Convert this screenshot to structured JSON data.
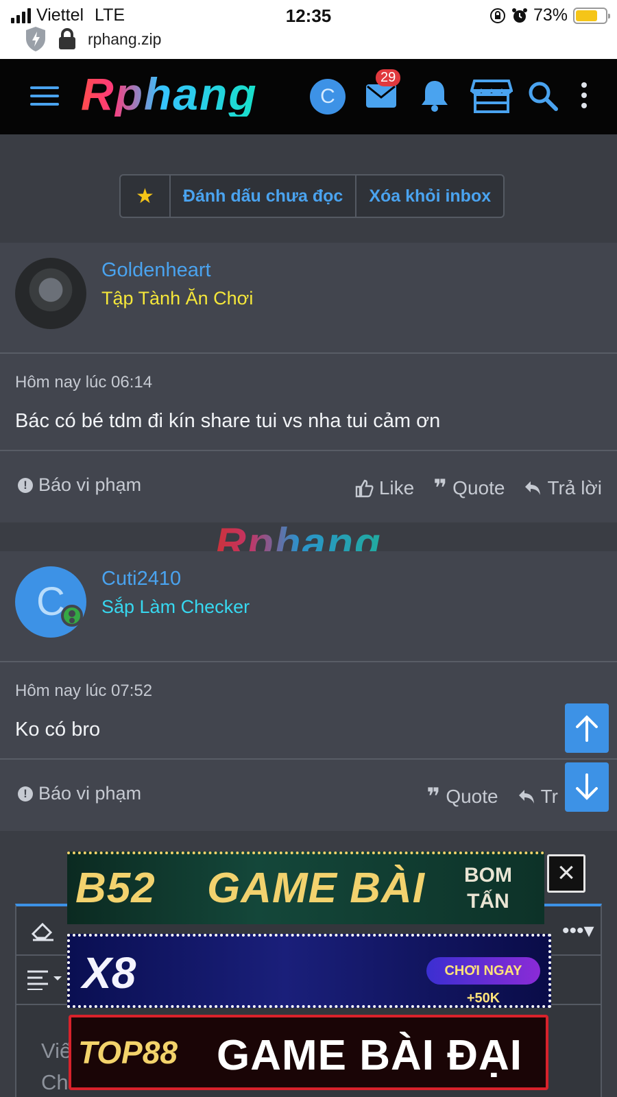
{
  "status_bar": {
    "carrier": "Viettel",
    "network": "LTE",
    "time": "12:35",
    "battery": "73%",
    "url": "rphang.zip"
  },
  "header": {
    "logo": "Rphang",
    "avatar_letter": "C",
    "mail_badge": "29"
  },
  "action_bar": {
    "star": "★",
    "mark_unread": "Đánh dấu chưa đọc",
    "remove_inbox": "Xóa khỏi inbox"
  },
  "posts": [
    {
      "username": "Goldenheart",
      "user_title": "Tập Tành Ăn Chơi",
      "title_color": "#f5e73a",
      "date": "Hôm nay lúc 06:14",
      "text": "Bác có bé tdm đi kín share tui vs nha tui cảm ơn",
      "report": "Báo vi phạm",
      "like": "Like",
      "quote": "Quote",
      "reply": "Trả lời"
    },
    {
      "username": "Cuti2410",
      "avatar_letter": "C",
      "user_title": "Sắp Làm Checker",
      "title_color": "#37d8f0",
      "date": "Hôm nay lúc 07:52",
      "text": "Ko có bro",
      "report": "Báo vi phạm",
      "quote": "Quote",
      "reply": "Tr"
    }
  ],
  "watermark": "Rphang",
  "editor": {
    "placeholder_line1": "Viế",
    "placeholder_line2": "Ch"
  },
  "ads": {
    "b52_brand": "B52",
    "b52_main": "GAME BÀI",
    "b52_side1": "BOM",
    "b52_side2": "TẤN",
    "x8_brand": "X8",
    "x8_cta": "CHƠI NGAY +50K",
    "top88_brand": "TOP88",
    "top88_text": "GAME BÀI ĐẠI GIA",
    "close": "×"
  },
  "colors": {
    "accent": "#3d92e6",
    "link": "#4aa3ef",
    "header_bg": "#050505",
    "page_bg": "#3a3d44",
    "post_bg": "#42454e"
  }
}
